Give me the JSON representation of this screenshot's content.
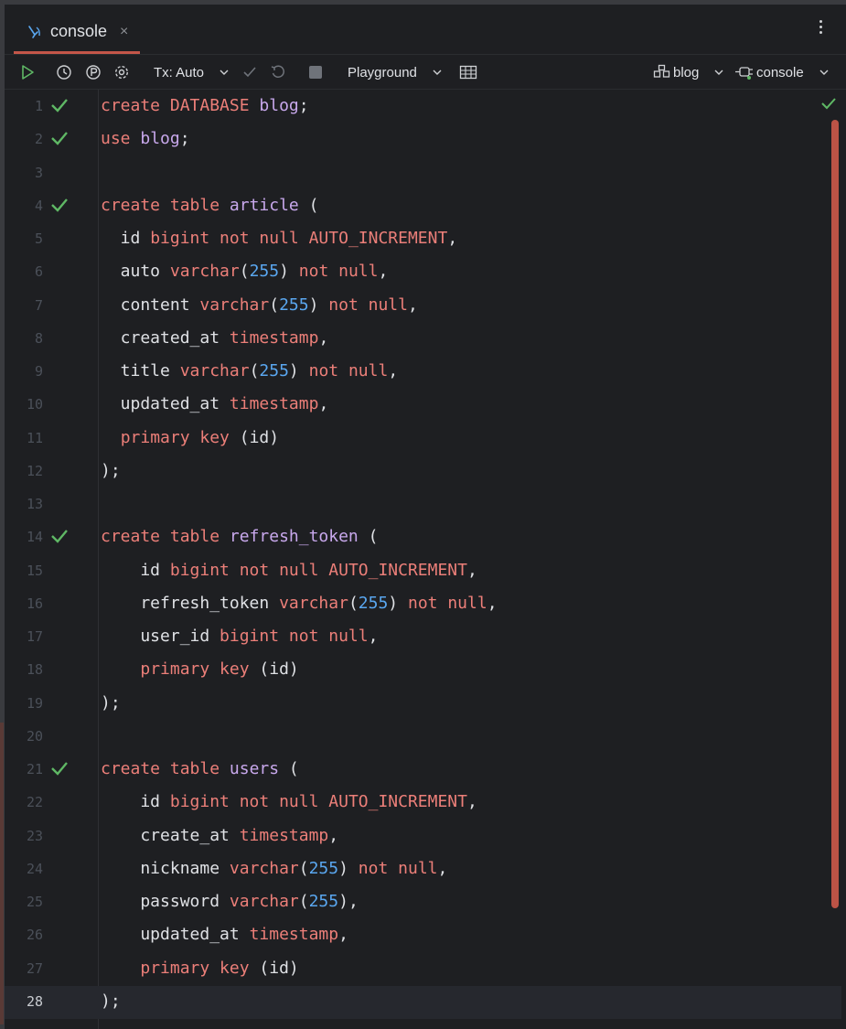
{
  "tab": {
    "label": "console",
    "close": "×"
  },
  "toolbar": {
    "tx_label": "Tx: Auto",
    "playground_label": "Playground",
    "schema_label": "blog",
    "session_label": "console"
  },
  "editor": {
    "current_line": 28,
    "lines": [
      {
        "n": "1",
        "ok": true,
        "tokens": [
          [
            "kw",
            "create "
          ],
          [
            "kw",
            "DATABASE "
          ],
          [
            "db",
            "blog"
          ],
          [
            "pl",
            ";"
          ]
        ]
      },
      {
        "n": "2",
        "ok": true,
        "tokens": [
          [
            "kw",
            "use "
          ],
          [
            "db",
            "blog"
          ],
          [
            "pl",
            ";"
          ]
        ]
      },
      {
        "n": "3",
        "ok": false,
        "tokens": []
      },
      {
        "n": "4",
        "ok": true,
        "tokens": [
          [
            "kw",
            "create "
          ],
          [
            "kw",
            "table "
          ],
          [
            "db",
            "article"
          ],
          [
            "pl",
            " ("
          ]
        ]
      },
      {
        "n": "5",
        "ok": false,
        "tokens": [
          [
            "pl",
            "  id "
          ],
          [
            "kw",
            "bigint "
          ],
          [
            "kw",
            "not null "
          ],
          [
            "kw",
            "AUTO_INCREMENT"
          ],
          [
            "pl",
            ","
          ]
        ]
      },
      {
        "n": "6",
        "ok": false,
        "tokens": [
          [
            "pl",
            "  auto "
          ],
          [
            "kw",
            "varchar"
          ],
          [
            "pl",
            "("
          ],
          [
            "num",
            "255"
          ],
          [
            "pl",
            ") "
          ],
          [
            "kw",
            "not null"
          ],
          [
            "pl",
            ","
          ]
        ]
      },
      {
        "n": "7",
        "ok": false,
        "tokens": [
          [
            "pl",
            "  content "
          ],
          [
            "kw",
            "varchar"
          ],
          [
            "pl",
            "("
          ],
          [
            "num",
            "255"
          ],
          [
            "pl",
            ") "
          ],
          [
            "kw",
            "not null"
          ],
          [
            "pl",
            ","
          ]
        ]
      },
      {
        "n": "8",
        "ok": false,
        "tokens": [
          [
            "pl",
            "  created_at "
          ],
          [
            "kw",
            "timestamp"
          ],
          [
            "pl",
            ","
          ]
        ]
      },
      {
        "n": "9",
        "ok": false,
        "tokens": [
          [
            "pl",
            "  title "
          ],
          [
            "kw",
            "varchar"
          ],
          [
            "pl",
            "("
          ],
          [
            "num",
            "255"
          ],
          [
            "pl",
            ") "
          ],
          [
            "kw",
            "not null"
          ],
          [
            "pl",
            ","
          ]
        ]
      },
      {
        "n": "10",
        "ok": false,
        "tokens": [
          [
            "pl",
            "  updated_at "
          ],
          [
            "kw",
            "timestamp"
          ],
          [
            "pl",
            ","
          ]
        ]
      },
      {
        "n": "11",
        "ok": false,
        "tokens": [
          [
            "pl",
            "  "
          ],
          [
            "kw",
            "primary key "
          ],
          [
            "pl",
            "(id)"
          ]
        ]
      },
      {
        "n": "12",
        "ok": false,
        "tokens": [
          [
            "pl",
            ");"
          ]
        ]
      },
      {
        "n": "13",
        "ok": false,
        "tokens": []
      },
      {
        "n": "14",
        "ok": true,
        "tokens": [
          [
            "kw",
            "create "
          ],
          [
            "kw",
            "table "
          ],
          [
            "db",
            "refresh_token"
          ],
          [
            "pl",
            " ("
          ]
        ]
      },
      {
        "n": "15",
        "ok": false,
        "tokens": [
          [
            "pl",
            "    id "
          ],
          [
            "kw",
            "bigint "
          ],
          [
            "kw",
            "not null "
          ],
          [
            "kw",
            "AUTO_INCREMENT"
          ],
          [
            "pl",
            ","
          ]
        ]
      },
      {
        "n": "16",
        "ok": false,
        "tokens": [
          [
            "pl",
            "    refresh_token "
          ],
          [
            "kw",
            "varchar"
          ],
          [
            "pl",
            "("
          ],
          [
            "num",
            "255"
          ],
          [
            "pl",
            ") "
          ],
          [
            "kw",
            "not null"
          ],
          [
            "pl",
            ","
          ]
        ]
      },
      {
        "n": "17",
        "ok": false,
        "tokens": [
          [
            "pl",
            "    user_id "
          ],
          [
            "kw",
            "bigint "
          ],
          [
            "kw",
            "not null"
          ],
          [
            "pl",
            ","
          ]
        ]
      },
      {
        "n": "18",
        "ok": false,
        "tokens": [
          [
            "pl",
            "    "
          ],
          [
            "kw",
            "primary key "
          ],
          [
            "pl",
            "(id)"
          ]
        ]
      },
      {
        "n": "19",
        "ok": false,
        "tokens": [
          [
            "pl",
            ");"
          ]
        ]
      },
      {
        "n": "20",
        "ok": false,
        "tokens": []
      },
      {
        "n": "21",
        "ok": true,
        "tokens": [
          [
            "kw",
            "create "
          ],
          [
            "kw",
            "table "
          ],
          [
            "db",
            "users"
          ],
          [
            "pl",
            " ("
          ]
        ]
      },
      {
        "n": "22",
        "ok": false,
        "tokens": [
          [
            "pl",
            "    id "
          ],
          [
            "kw",
            "bigint "
          ],
          [
            "kw",
            "not null "
          ],
          [
            "kw",
            "AUTO_INCREMENT"
          ],
          [
            "pl",
            ","
          ]
        ]
      },
      {
        "n": "23",
        "ok": false,
        "tokens": [
          [
            "pl",
            "    create_at "
          ],
          [
            "kw",
            "timestamp"
          ],
          [
            "pl",
            ","
          ]
        ]
      },
      {
        "n": "24",
        "ok": false,
        "tokens": [
          [
            "pl",
            "    nickname "
          ],
          [
            "kw",
            "varchar"
          ],
          [
            "pl",
            "("
          ],
          [
            "num",
            "255"
          ],
          [
            "pl",
            ") "
          ],
          [
            "kw",
            "not null"
          ],
          [
            "pl",
            ","
          ]
        ]
      },
      {
        "n": "25",
        "ok": false,
        "tokens": [
          [
            "pl",
            "    password "
          ],
          [
            "kw",
            "varchar"
          ],
          [
            "pl",
            "("
          ],
          [
            "num",
            "255"
          ],
          [
            "pl",
            "),"
          ]
        ]
      },
      {
        "n": "26",
        "ok": false,
        "tokens": [
          [
            "pl",
            "    updated_at "
          ],
          [
            "kw",
            "timestamp"
          ],
          [
            "pl",
            ","
          ]
        ]
      },
      {
        "n": "27",
        "ok": false,
        "tokens": [
          [
            "pl",
            "    "
          ],
          [
            "kw",
            "primary key "
          ],
          [
            "pl",
            "(id)"
          ]
        ]
      },
      {
        "n": "28",
        "ok": false,
        "tokens": [
          [
            "pl",
            ");"
          ]
        ]
      }
    ]
  },
  "colors": {
    "accent": "#c45649",
    "keyword": "#ec7f79",
    "identifier": "#c8a8ec",
    "number": "#5aa7f0",
    "success": "#5fb865",
    "background": "#1e1f22"
  }
}
